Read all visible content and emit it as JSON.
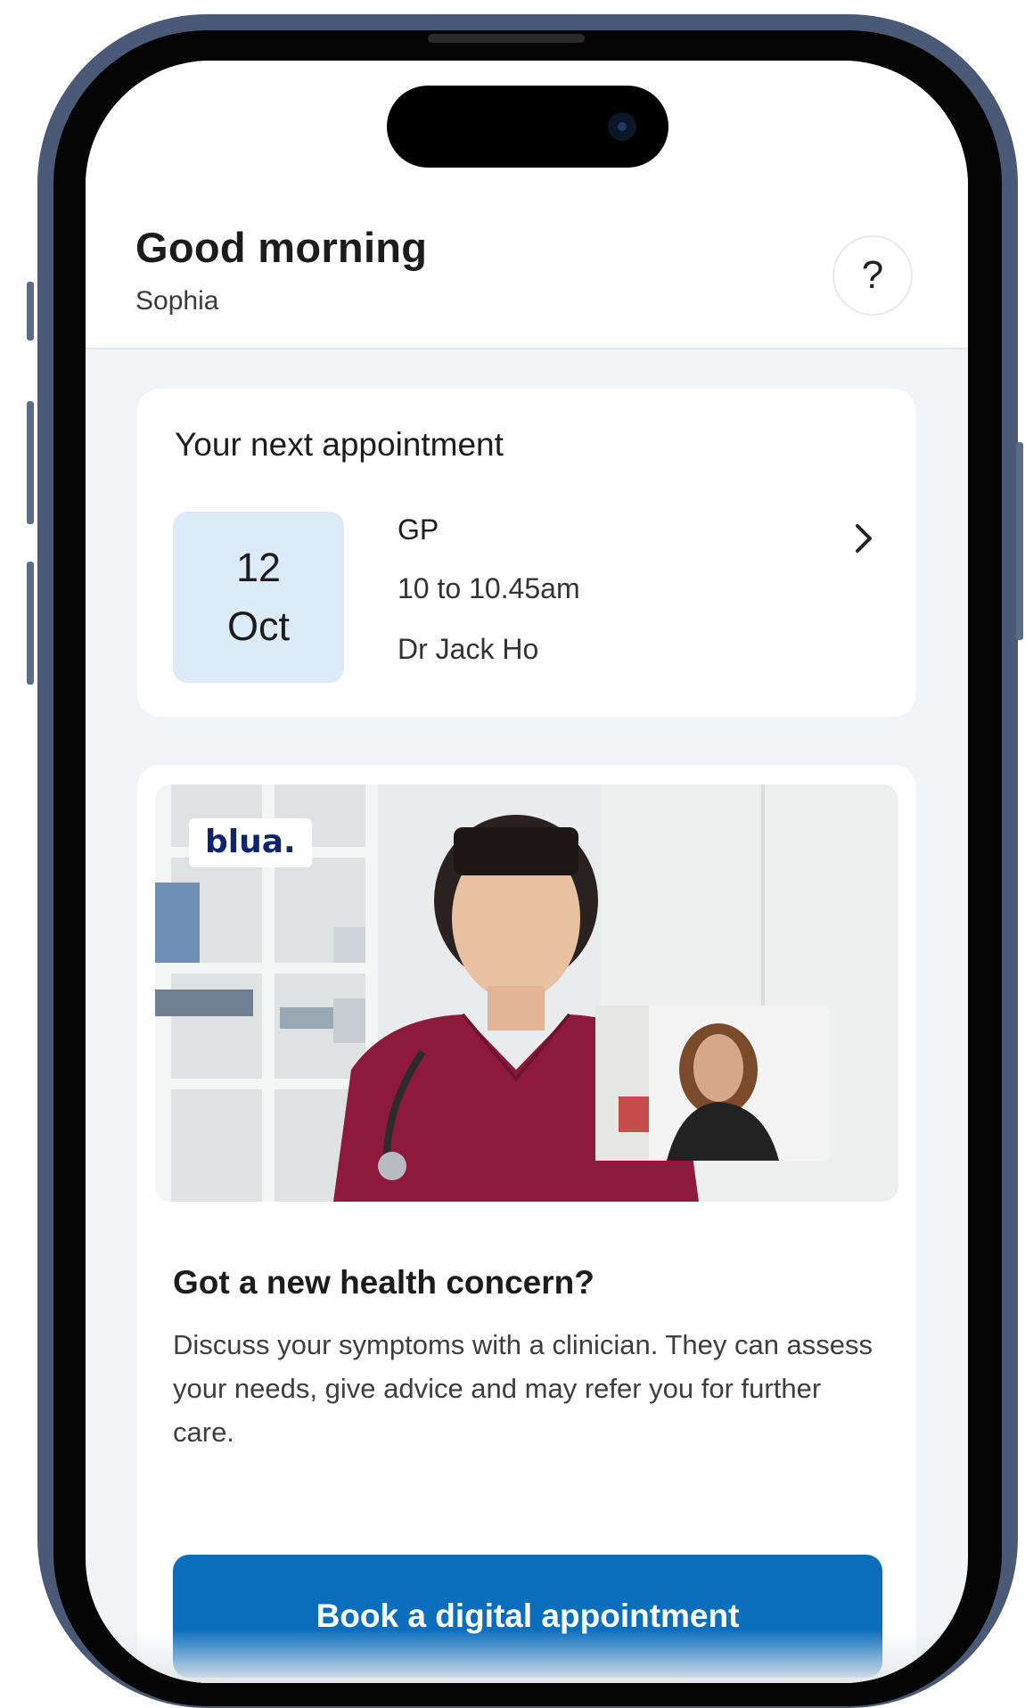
{
  "header": {
    "greeting": "Good morning",
    "user_name": "Sophia",
    "help_label": "?"
  },
  "appointment": {
    "heading": "Your next appointment",
    "day": "12",
    "month": "Oct",
    "type": "GP",
    "time": "10 to 10.45am",
    "doctor": "Dr Jack Ho"
  },
  "promo": {
    "brand_logo": "blua.",
    "title": "Got a new health concern?",
    "body": "Discuss your symptoms with a clinician. They can assess your needs, give advice and may refer you for further care.",
    "button_label": "Book a digital appointment"
  },
  "colors": {
    "accent": "#0a6ebd",
    "date_box": "#dcebf7",
    "page_bg": "#f2f5f8",
    "frame": "#4a5a76"
  },
  "icons": {
    "help": "question-mark-icon",
    "chevron": "chevron-right-icon",
    "camera": "camera-icon"
  }
}
